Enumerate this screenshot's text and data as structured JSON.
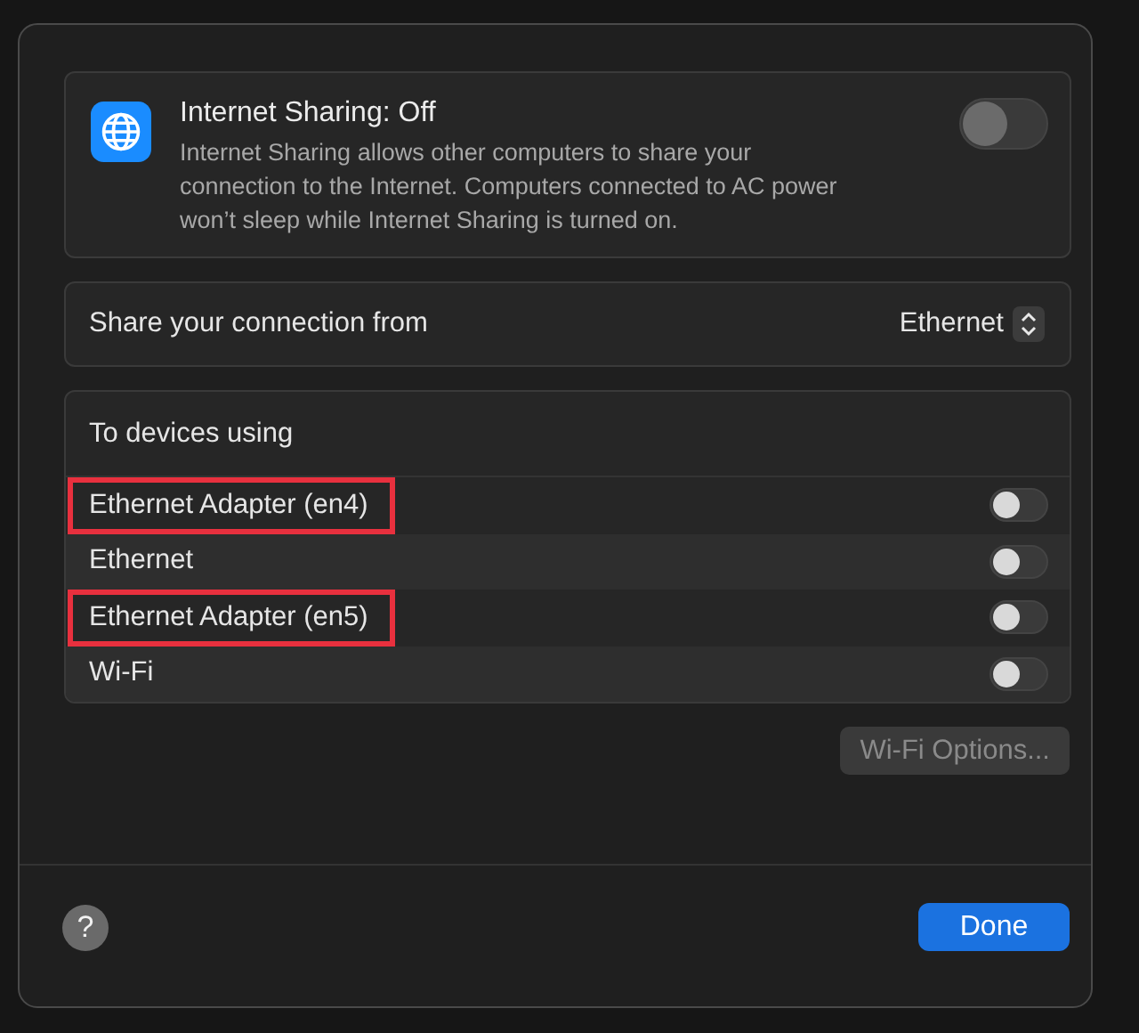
{
  "sharing": {
    "title": "Internet Sharing: Off",
    "description": "Internet Sharing allows other computers to share your connection to the Internet. Computers connected to AC power won’t sleep while Internet Sharing is turned on.",
    "on": false
  },
  "share_from": {
    "label": "Share your connection from",
    "value": "Ethernet"
  },
  "devices": {
    "heading": "To devices using",
    "items": [
      {
        "name": "Ethernet Adapter (en4)",
        "on": false,
        "highlighted": true
      },
      {
        "name": "Ethernet",
        "on": false,
        "highlighted": false
      },
      {
        "name": "Ethernet Adapter (en5)",
        "on": false,
        "highlighted": true
      },
      {
        "name": "Wi-Fi",
        "on": false,
        "highlighted": false
      }
    ]
  },
  "wifi_options": {
    "label": "Wi-Fi Options...",
    "disabled": true
  },
  "help": {
    "label": "?"
  },
  "done": {
    "label": "Done"
  }
}
